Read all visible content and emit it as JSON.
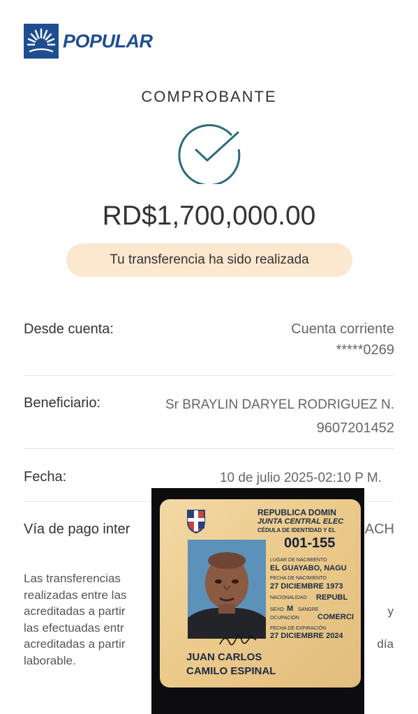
{
  "brand": {
    "name": "POPULAR"
  },
  "header": {
    "title": "COMPROBANTE"
  },
  "receipt": {
    "amount": "RD$1,700,000.00",
    "status_message": "Tu transferencia ha sido realizada"
  },
  "details": {
    "from": {
      "label": "Desde cuenta:",
      "value_line1": "Cuenta corriente",
      "value_line2": "*****0269"
    },
    "beneficiary": {
      "label": "Beneficiario:",
      "name": "Sr BRAYLIN DARYEL RODRIGUEZ N.",
      "account": "9607201452"
    },
    "date": {
      "label": "Fecha:",
      "value": "10 de julio 2025-02:10 P M."
    },
    "payment_method": {
      "label": "Vía de pago inter",
      "value": "ACH"
    }
  },
  "note": {
    "lines": [
      {
        "left": "Las transferencias",
        "right": ""
      },
      {
        "left": "realizadas entre las",
        "right": ""
      },
      {
        "left": "acreditadas a partir",
        "right": "y"
      },
      {
        "left": "las efectuadas entr",
        "right": ""
      },
      {
        "left": "acreditadas a partir",
        "right": "día"
      },
      {
        "left": "laborable.",
        "right": ""
      }
    ]
  },
  "id_card": {
    "country": "REPUBLICA DOMIN",
    "institution": "JUNTA CENTRAL ELEC",
    "doc_type": "CÉDULA DE IDENTIDAD Y EL",
    "number": "001-155",
    "birthplace_label": "LUGAR DE NACIMIENTO",
    "birthplace": "EL GUAYABO, NAGU",
    "birthdate_label": "FECHA DE NACIMIENTO",
    "birthdate": "27 DICIEMBRE 1973",
    "nationality_label": "NACIONALIDAD",
    "nationality": "REPUBL",
    "sex_label": "SEXO:",
    "sex": "M",
    "blood_label": "SANGRE",
    "occupation_label": "OCUPACIÓN",
    "occupation": "COMERCI",
    "expiry_label": "FECHA DE EXPIRACIÓN",
    "expiry": "27 DICIEMBRE 2024",
    "name_line1": "JUAN CARLOS",
    "name_line2": "CAMILO ESPINAL"
  }
}
